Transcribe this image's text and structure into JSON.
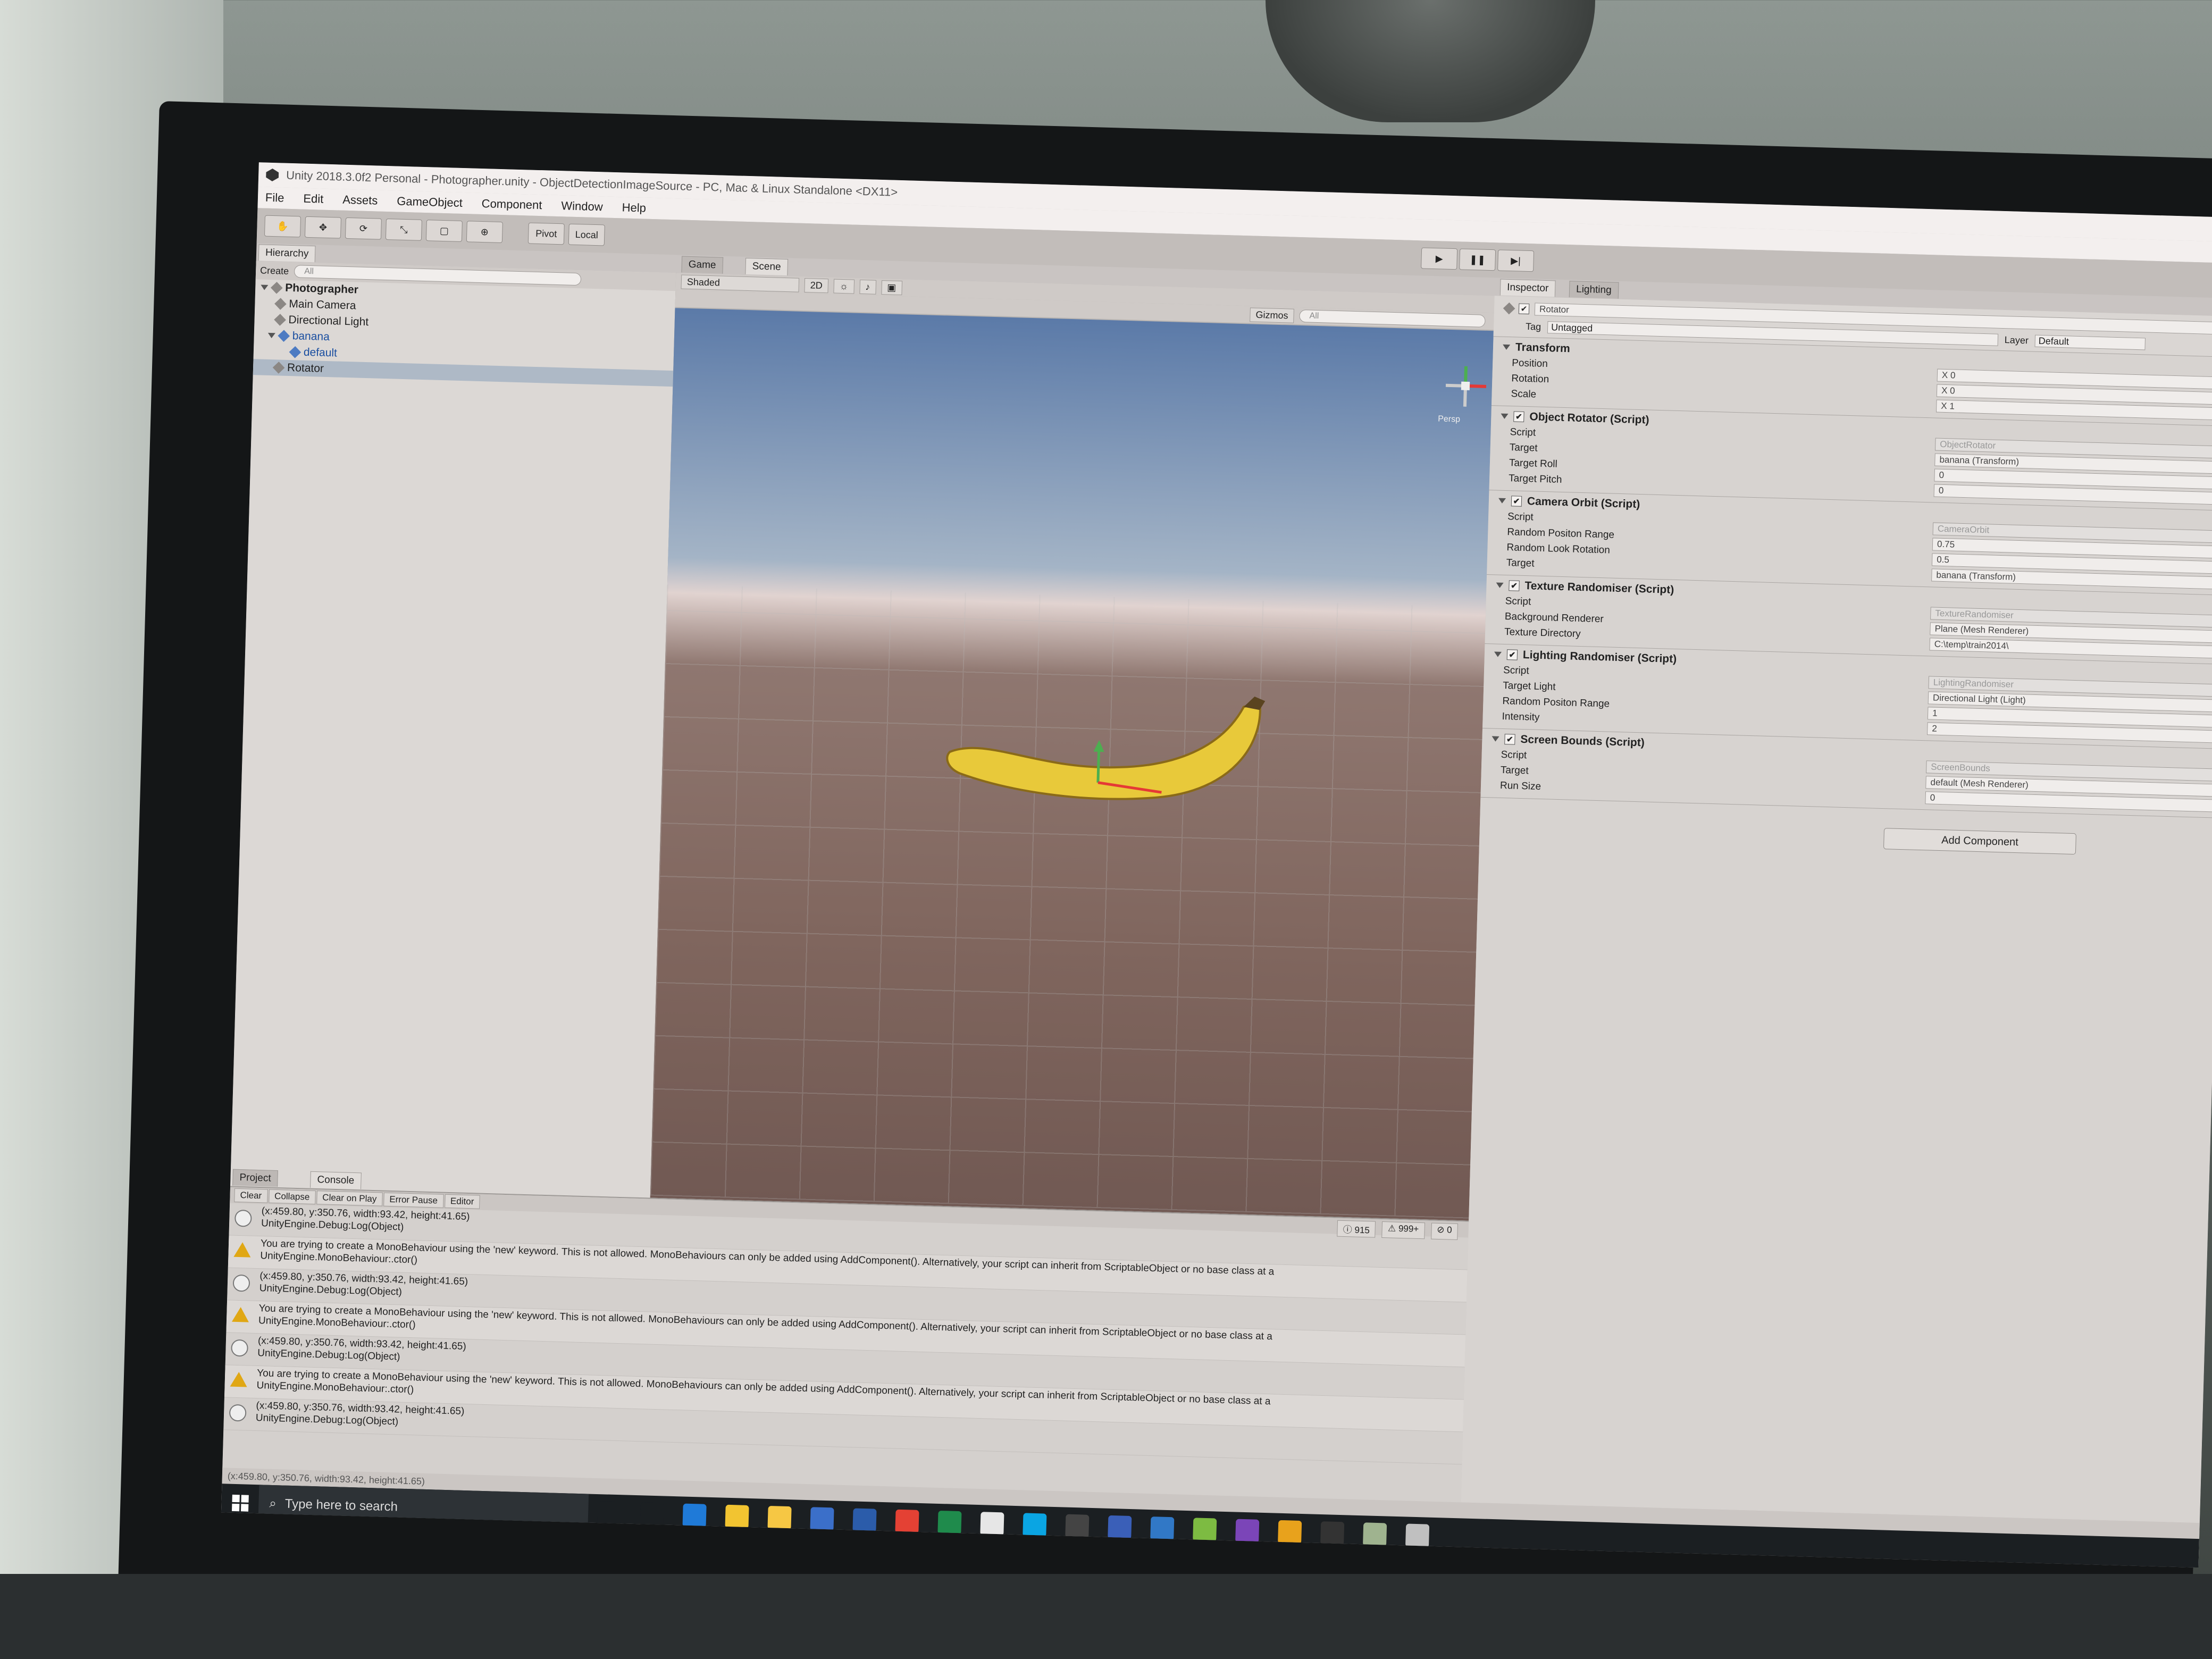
{
  "window": {
    "title": "Unity 2018.3.0f2 Personal - Photographer.unity - ObjectDetectionImageSource - PC, Mac & Linux Standalone <DX11>"
  },
  "menu": [
    "File",
    "Edit",
    "Assets",
    "GameObject",
    "Component",
    "Window",
    "Help"
  ],
  "toolbar": {
    "pivot": "Pivot",
    "local": "Local"
  },
  "hierarchy": {
    "tab": "Hierarchy",
    "create": "Create",
    "search_placeholder": "All",
    "items": [
      {
        "label": "Photographer",
        "level": 0
      },
      {
        "label": "Main Camera",
        "level": 1
      },
      {
        "label": "Directional Light",
        "level": 1
      },
      {
        "label": "banana",
        "level": 1
      },
      {
        "label": "default",
        "level": 2
      },
      {
        "label": "Rotator",
        "level": 1,
        "selected": true
      }
    ]
  },
  "scene": {
    "tabs": [
      "Game",
      "Scene"
    ],
    "active_tab": "Scene",
    "shading": "Shaded",
    "mode2d": "2D",
    "gizmos": "Gizmos",
    "search_placeholder": "All",
    "persp": "Persp"
  },
  "inspector": {
    "tabs": [
      "Inspector",
      "Lighting"
    ],
    "object_name": "Rotator",
    "tag_label": "Tag",
    "tag": "Untagged",
    "layer_label": "Layer",
    "layer": "Default",
    "components": [
      {
        "title": "Transform",
        "has_check": false,
        "props": [
          {
            "label": "Position",
            "value": "X 0"
          },
          {
            "label": "Rotation",
            "value": "X 0"
          },
          {
            "label": "Scale",
            "value": "X 1"
          }
        ]
      },
      {
        "title": "Object Rotator (Script)",
        "has_check": true,
        "props": [
          {
            "label": "Script",
            "value": "ObjectRotator",
            "ro": true
          },
          {
            "label": "Target",
            "value": "banana (Transform)"
          },
          {
            "label": "Target Roll",
            "value": "0"
          },
          {
            "label": "Target Pitch",
            "value": "0"
          }
        ]
      },
      {
        "title": "Camera Orbit (Script)",
        "has_check": true,
        "props": [
          {
            "label": "Script",
            "value": "CameraOrbit",
            "ro": true
          },
          {
            "label": "Random Positon Range",
            "value": "0.75"
          },
          {
            "label": "Random Look Rotation",
            "value": "0.5"
          },
          {
            "label": "Target",
            "value": "banana (Transform)"
          }
        ]
      },
      {
        "title": "Texture Randomiser (Script)",
        "has_check": true,
        "props": [
          {
            "label": "Script",
            "value": "TextureRandomiser",
            "ro": true
          },
          {
            "label": "Background Renderer",
            "value": "Plane (Mesh Renderer)"
          },
          {
            "label": "Texture Directory",
            "value": "C:\\temp\\train2014\\"
          }
        ]
      },
      {
        "title": "Lighting Randomiser (Script)",
        "has_check": true,
        "props": [
          {
            "label": "Script",
            "value": "LightingRandomiser",
            "ro": true
          },
          {
            "label": "Target Light",
            "value": "Directional Light (Light)"
          },
          {
            "label": "Random Positon Range",
            "value": "1"
          },
          {
            "label": "Intensity",
            "value": "2"
          }
        ]
      },
      {
        "title": "Screen Bounds (Script)",
        "has_check": true,
        "props": [
          {
            "label": "Script",
            "value": "ScreenBounds",
            "ro": true
          },
          {
            "label": "Target",
            "value": "default (Mesh Renderer)"
          },
          {
            "label": "Run Size",
            "value": "0"
          }
        ]
      }
    ],
    "add_component": "Add Component"
  },
  "console": {
    "tabs": [
      "Project",
      "Console"
    ],
    "buttons": [
      "Clear",
      "Collapse",
      "Clear on Play",
      "Error Pause",
      "Editor"
    ],
    "counts": {
      "info": "915",
      "warn": "999+",
      "error": "0"
    },
    "logs": [
      {
        "type": "info",
        "line1": "(x:459.80, y:350.76, width:93.42, height:41.65)",
        "line2": "UnityEngine.Debug:Log(Object)"
      },
      {
        "type": "warn",
        "line1": "You are trying to create a MonoBehaviour using the 'new' keyword.  This is not allowed.  MonoBehaviours can only be added using AddComponent(). Alternatively, your script can inherit from ScriptableObject or no base class at a",
        "line2": "UnityEngine.MonoBehaviour:.ctor()"
      },
      {
        "type": "info",
        "line1": "(x:459.80, y:350.76, width:93.42, height:41.65)",
        "line2": "UnityEngine.Debug:Log(Object)"
      },
      {
        "type": "warn",
        "line1": "You are trying to create a MonoBehaviour using the 'new' keyword.  This is not allowed.  MonoBehaviours can only be added using AddComponent(). Alternatively, your script can inherit from ScriptableObject or no base class at a",
        "line2": "UnityEngine.MonoBehaviour:.ctor()"
      },
      {
        "type": "info",
        "line1": "(x:459.80, y:350.76, width:93.42, height:41.65)",
        "line2": "UnityEngine.Debug:Log(Object)"
      },
      {
        "type": "warn",
        "line1": "You are trying to create a MonoBehaviour using the 'new' keyword.  This is not allowed.  MonoBehaviours can only be added using AddComponent(). Alternatively, your script can inherit from ScriptableObject or no base class at a",
        "line2": "UnityEngine.MonoBehaviour:.ctor()"
      },
      {
        "type": "info",
        "line1": "(x:459.80, y:350.76, width:93.42, height:41.65)",
        "line2": "UnityEngine.Debug:Log(Object)"
      }
    ]
  },
  "statusbar": "(x:459.80, y:350.76, width:93.42, height:41.65)",
  "taskbar": {
    "search_placeholder": "Type here to search",
    "apps": [
      {
        "name": "cortana-icon",
        "color": "#1b1f22"
      },
      {
        "name": "task-view-icon",
        "color": "#1b1f22"
      },
      {
        "name": "edge-icon",
        "color": "#1f7ad8"
      },
      {
        "name": "file-explorer-icon",
        "color": "#f2c431"
      },
      {
        "name": "store-icon",
        "color": "#f6c744"
      },
      {
        "name": "keepass-icon",
        "color": "#3b6fc9"
      },
      {
        "name": "powershell-icon",
        "color": "#2b5caa"
      },
      {
        "name": "chrome-icon",
        "color": "#e44134"
      },
      {
        "name": "excel-icon",
        "color": "#1f8b4c"
      },
      {
        "name": "mail-icon",
        "color": "#e6e6e6"
      },
      {
        "name": "skype-icon",
        "color": "#0aa5e3"
      },
      {
        "name": "unity-icon",
        "color": "#444444"
      },
      {
        "name": "visio-icon",
        "color": "#3a5fb8"
      },
      {
        "name": "db-icon",
        "color": "#3178c6"
      },
      {
        "name": "notepad-icon",
        "color": "#7dbb42"
      },
      {
        "name": "visual-studio-icon",
        "color": "#7b45b8"
      },
      {
        "name": "git-icon",
        "color": "#e8a21c"
      },
      {
        "name": "terminal-icon",
        "color": "#333333"
      },
      {
        "name": "app-icon",
        "color": "#9fb38f"
      },
      {
        "name": "tools-icon",
        "color": "#c0c0c0"
      }
    ]
  }
}
